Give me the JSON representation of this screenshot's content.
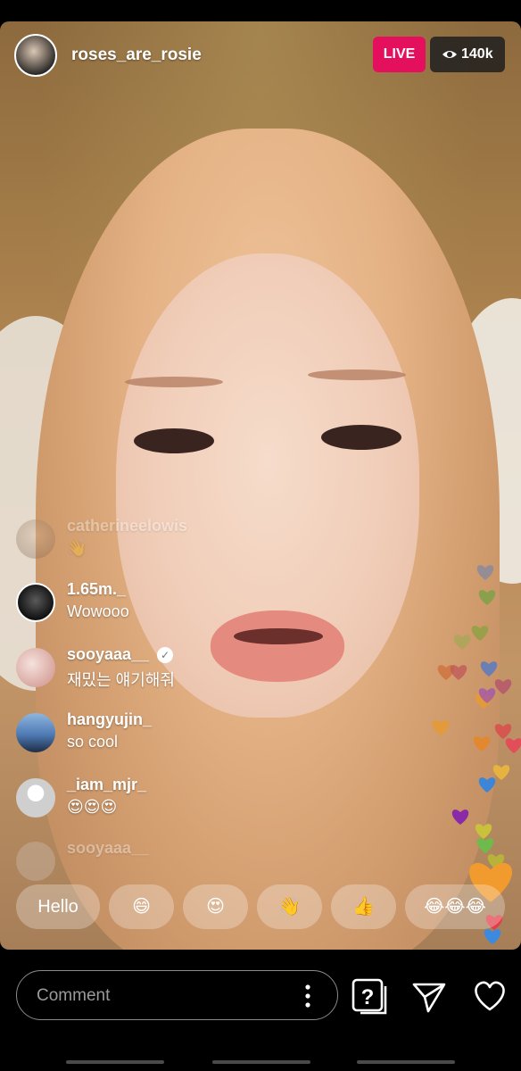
{
  "header": {
    "username": "roses_are_rosie",
    "live_label": "LIVE",
    "viewers": "140k",
    "viewer_icon": "eye-icon"
  },
  "comments": [
    {
      "user": "catherineelowis",
      "text": "👋",
      "faded": true
    },
    {
      "user": "1.65m._",
      "text": "Wowooo"
    },
    {
      "user": "sooyaaa__",
      "text": "재밌는 얘기해줘",
      "verified": true
    },
    {
      "user": "hangyujin_",
      "text": "so cool"
    },
    {
      "user": "_iam_mjr_",
      "text": "😍😍😍"
    },
    {
      "user": "sooyaaa__",
      "text": "",
      "faded": true
    }
  ],
  "quick_replies": [
    "Hello",
    "😄",
    "😍",
    "👋",
    "👍",
    "😂😂😂"
  ],
  "comment_box": {
    "placeholder": "Comment"
  },
  "actions": {
    "question_icon": "question-icon",
    "send_icon": "send-icon",
    "like_icon": "heart-icon"
  },
  "colors": {
    "live": "#e4105e"
  }
}
